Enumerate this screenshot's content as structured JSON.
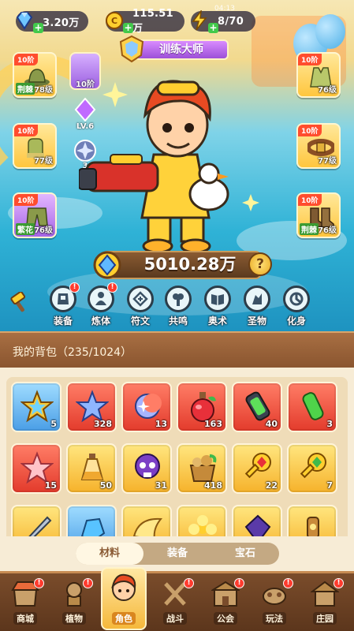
{
  "resources": {
    "gems": {
      "value": "3.20万",
      "icon": "diamond-icon"
    },
    "coins": {
      "value": "115.51万",
      "icon": "coin-icon"
    },
    "energy": {
      "value": "8/70",
      "icon": "lightning-icon",
      "timer": "04:13"
    }
  },
  "title": "训练大师",
  "left_slots": [
    {
      "tier": "10阶",
      "level": "78级",
      "tag": "荆棘",
      "rarity": "gold",
      "icon": "hat-icon"
    },
    {
      "tier": "10阶",
      "level": "77级",
      "tag": "",
      "rarity": "gold",
      "icon": "gloves-icon"
    },
    {
      "tier": "10阶",
      "level": "76级",
      "tag": "繁花",
      "rarity": "purple",
      "icon": "pants-icon"
    }
  ],
  "right_slots": [
    {
      "tier": "10阶",
      "level": "76级",
      "tag": "",
      "rarity": "gold",
      "icon": "vest-icon"
    },
    {
      "tier": "10阶",
      "level": "77级",
      "tag": "",
      "rarity": "gold",
      "icon": "belt-icon"
    },
    {
      "tier": "10阶",
      "level": "76级",
      "tag": "荆棘",
      "rarity": "gold",
      "icon": "boots-icon"
    }
  ],
  "midcol": {
    "tier": "10阶",
    "level": "LV.6",
    "count": "3"
  },
  "power": "5010.28万",
  "help": "?",
  "actions": [
    {
      "label": "装备",
      "icon": "equip-icon",
      "alert": true
    },
    {
      "label": "炼体",
      "icon": "body-icon",
      "alert": true
    },
    {
      "label": "符文",
      "icon": "rune-icon",
      "alert": false
    },
    {
      "label": "共鸣",
      "icon": "resonance-icon",
      "alert": false
    },
    {
      "label": "奥术",
      "icon": "arcane-book-icon",
      "alert": false
    },
    {
      "label": "圣物",
      "icon": "relic-icon",
      "alert": false
    },
    {
      "label": "化身",
      "icon": "avatar-icon",
      "alert": false
    }
  ],
  "bag": {
    "title": "我的背包（235/1024）",
    "items": [
      {
        "rarity": "blue",
        "count": "5",
        "icon": "star-badge-icon"
      },
      {
        "rarity": "red",
        "count": "328",
        "icon": "blue-star-icon"
      },
      {
        "rarity": "red",
        "count": "13",
        "icon": "moon-star-icon"
      },
      {
        "rarity": "red",
        "count": "163",
        "icon": "potion-icon"
      },
      {
        "rarity": "red",
        "count": "40",
        "icon": "battery-icon"
      },
      {
        "rarity": "red",
        "count": "3",
        "icon": "green-crystal-icon"
      },
      {
        "rarity": "red",
        "count": "15",
        "icon": "pink-star-icon"
      },
      {
        "rarity": "gold",
        "count": "50",
        "icon": "sand-flask-icon"
      },
      {
        "rarity": "gold",
        "count": "31",
        "icon": "skull-icon"
      },
      {
        "rarity": "gold",
        "count": "418",
        "icon": "basket-icon"
      },
      {
        "rarity": "gold",
        "count": "22",
        "icon": "ruby-key-icon"
      },
      {
        "rarity": "gold",
        "count": "7",
        "icon": "emerald-key-icon"
      },
      {
        "rarity": "gold",
        "count": "",
        "icon": "blade-icon"
      },
      {
        "rarity": "blue",
        "count": "",
        "icon": "blue-ore-icon"
      },
      {
        "rarity": "gold",
        "count": "",
        "icon": "wing-icon"
      },
      {
        "rarity": "gold",
        "count": "",
        "icon": "flower-icon"
      },
      {
        "rarity": "gold",
        "count": "",
        "icon": "purple-gem-icon"
      },
      {
        "rarity": "gold",
        "count": "",
        "icon": "lantern-icon"
      }
    ]
  },
  "tabs": [
    "材料",
    "装备",
    "宝石"
  ],
  "active_tab": 0,
  "nav": [
    {
      "label": "商城",
      "icon": "shop-icon",
      "alert": true
    },
    {
      "label": "植物",
      "icon": "plant-icon",
      "alert": true
    },
    {
      "label": "角色",
      "icon": "hero-portrait-icon",
      "alert": false
    },
    {
      "label": "战斗",
      "icon": "crossed-swords-icon",
      "alert": true
    },
    {
      "label": "公会",
      "icon": "guild-icon",
      "alert": true
    },
    {
      "label": "玩法",
      "icon": "play-icon",
      "alert": true
    },
    {
      "label": "庄园",
      "icon": "manor-icon",
      "alert": true
    }
  ],
  "active_nav": 2,
  "colors": {
    "accent": "#f5b83b",
    "alert": "#ff3b2e",
    "panel": "#f7ecd6",
    "header": "#9a6238"
  }
}
